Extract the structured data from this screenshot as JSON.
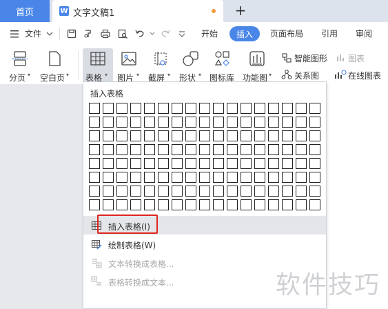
{
  "tabs": {
    "home": "首页",
    "document": "文字文稿1",
    "new_tab": "+"
  },
  "menu": {
    "file": "文件",
    "items": [
      "开始",
      "插入",
      "页面布局",
      "引用",
      "审阅"
    ]
  },
  "ribbon": {
    "page_break": "分页",
    "blank_page": "空白页",
    "table": "表格",
    "picture": "图片",
    "screenshot": "截屏",
    "shapes": "形状",
    "icon_library": "图标库",
    "functional_chart": "功能图",
    "smart_art": "智能图形",
    "chart": "图表",
    "relation_chart": "关系图",
    "online_chart": "在线图表"
  },
  "dropdown": {
    "title": "插入表格",
    "grid_rows": 8,
    "grid_cols": 17,
    "items": [
      {
        "label": "插入表格(I)",
        "enabled": true,
        "highlighted": true
      },
      {
        "label": "绘制表格(W)",
        "enabled": true,
        "highlighted": false
      },
      {
        "label": "文本转换成表格...",
        "enabled": false,
        "highlighted": false
      },
      {
        "label": "表格转换成文本...",
        "enabled": false,
        "highlighted": false
      }
    ]
  },
  "watermark": "软件技巧",
  "colors": {
    "accent": "#4a86e8",
    "unsaved_dot": "#f39a3a",
    "highlight_box": "#e0241f",
    "tab_bar": "#dde3ec"
  }
}
